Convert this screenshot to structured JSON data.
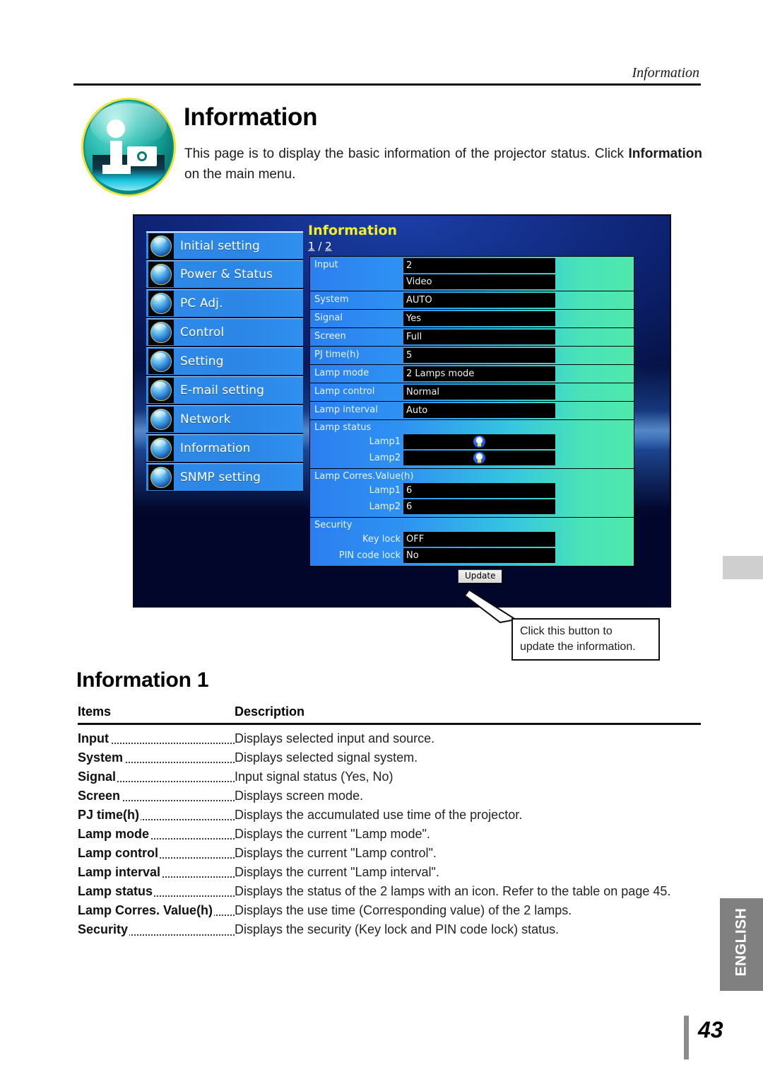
{
  "running_head": {
    "text": "Information"
  },
  "title_block": {
    "badge_icon": "information-badge-icon",
    "title": "Information",
    "intro_pre": "This page is to display the basic information of the projector status. Click ",
    "intro_bold": "Information",
    "intro_post": " on the main menu."
  },
  "screenshot": {
    "sidebar": {
      "items": [
        {
          "label": "Initial setting",
          "icon": "initial-setting-orb-icon"
        },
        {
          "label": "Power & Status",
          "icon": "power-status-orb-icon"
        },
        {
          "label": "PC Adj.",
          "icon": "pc-adj-orb-icon"
        },
        {
          "label": "Control",
          "icon": "control-orb-icon"
        },
        {
          "label": "Setting",
          "icon": "setting-orb-icon"
        },
        {
          "label": "E-mail setting",
          "icon": "email-setting-orb-icon"
        },
        {
          "label": "Network",
          "icon": "network-orb-icon"
        },
        {
          "label": "Information",
          "icon": "information-orb-icon"
        },
        {
          "label": "SNMP setting",
          "icon": "snmp-setting-orb-icon"
        }
      ]
    },
    "pane": {
      "title": "Information",
      "page_current": "1",
      "page_separator": " / ",
      "page_total": "2",
      "rows": [
        {
          "label": "Input",
          "values": [
            "2",
            "Video"
          ]
        },
        {
          "label": "System",
          "values": [
            "AUTO"
          ]
        },
        {
          "label": "Signal",
          "values": [
            "Yes"
          ]
        },
        {
          "label": "Screen",
          "values": [
            "Full"
          ]
        },
        {
          "label": "PJ time(h)",
          "values": [
            "5"
          ]
        },
        {
          "label": "Lamp mode",
          "values": [
            "2 Lamps mode"
          ]
        },
        {
          "label": "Lamp control",
          "values": [
            "Normal"
          ]
        },
        {
          "label": "Lamp interval",
          "values": [
            "Auto"
          ]
        }
      ],
      "groups": [
        {
          "title": "Lamp status",
          "sub": [
            {
              "label": "Lamp1",
              "value": "",
              "icon": "lamp-bulb-icon"
            },
            {
              "label": "Lamp2",
              "value": "",
              "icon": "lamp-bulb-icon"
            }
          ]
        },
        {
          "title": "Lamp Corres.Value(h)",
          "sub": [
            {
              "label": "Lamp1",
              "value": "6",
              "icon": ""
            },
            {
              "label": "Lamp2",
              "value": "6",
              "icon": ""
            }
          ]
        },
        {
          "title": "Security",
          "sub": [
            {
              "label": "Key lock",
              "value": "OFF",
              "icon": ""
            },
            {
              "label": "PIN code lock",
              "value": "No",
              "icon": ""
            }
          ]
        }
      ],
      "update_button": "Update"
    }
  },
  "callout": {
    "line1": "Click this button to",
    "line2": "update the information."
  },
  "section": {
    "title": "Information 1",
    "header_items": "Items",
    "header_description": "Description",
    "rows": [
      {
        "name": "Input",
        "desc": "Displays selected input and source."
      },
      {
        "name": "System",
        "desc": "Displays selected signal system."
      },
      {
        "name": "Signal",
        "desc": "Input signal status (Yes, No)"
      },
      {
        "name": "Screen",
        "desc": "Displays screen mode."
      },
      {
        "name": "PJ time(h)",
        "desc": "Displays the accumulated use time of the projector."
      },
      {
        "name": "Lamp mode",
        "desc": "Displays the current \"Lamp mode\"."
      },
      {
        "name": "Lamp control",
        "desc": "Displays the current \"Lamp control\"."
      },
      {
        "name": "Lamp interval",
        "desc": "Displays the current \"Lamp interval\"."
      },
      {
        "name": "Lamp status",
        "desc": "Displays the status of the 2 lamps with an icon. Refer to the table on page 45."
      },
      {
        "name": "Lamp Corres. Value(h)",
        "desc": "Displays the use time (Corresponding value) of the 2 lamps."
      },
      {
        "name": "Security",
        "desc": "Displays the security (Key lock and PIN code lock) status."
      }
    ]
  },
  "edge": {
    "language_tab": "ENGLISH",
    "page_number": "43"
  },
  "colors": {
    "pane_title": "#f5ef2a",
    "menu_blue": "#2b86e6",
    "table_gradient_start": "#2b7ff0",
    "table_gradient_end": "#4fe8ae",
    "value_box": "#000000",
    "english_tab": "#808080",
    "gray_tab": "#cfcfcf"
  }
}
